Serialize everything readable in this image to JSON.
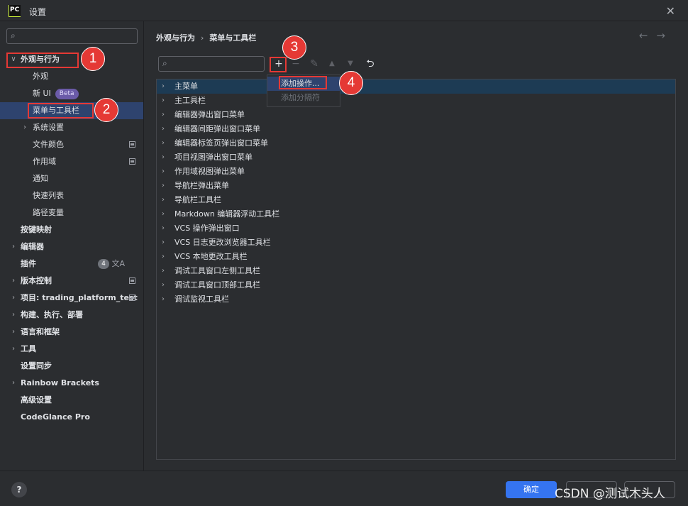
{
  "window": {
    "logo_text": "PC",
    "title": "设置",
    "close": "✕"
  },
  "sidebar": {
    "search_icon": "⌕",
    "items": [
      {
        "label": "外观与行为",
        "expanded": true,
        "bold": true
      },
      {
        "label": "外观"
      },
      {
        "label": "新 UI",
        "badge": "Beta"
      },
      {
        "label": "菜单与工具栏",
        "selected": true
      },
      {
        "label": "系统设置",
        "collapsed": true
      },
      {
        "label": "文件颜色"
      },
      {
        "label": "作用域"
      },
      {
        "label": "通知"
      },
      {
        "label": "快速列表"
      },
      {
        "label": "路径变量"
      },
      {
        "label": "按键映射",
        "bold": true
      },
      {
        "label": "编辑器",
        "bold": true
      },
      {
        "label": "插件",
        "bold": true,
        "count": "4",
        "translate_icon": "文A"
      },
      {
        "label": "版本控制",
        "bold": true
      },
      {
        "label": "项目: trading_platform_test",
        "bold": true
      },
      {
        "label": "构建、执行、部署",
        "bold": true
      },
      {
        "label": "语言和框架",
        "bold": true
      },
      {
        "label": "工具",
        "bold": true
      },
      {
        "label": "设置同步",
        "bold": true
      },
      {
        "label": "Rainbow Brackets",
        "bold": true
      },
      {
        "label": "高级设置",
        "bold": true
      },
      {
        "label": "CodeGlance Pro",
        "bold": true
      }
    ]
  },
  "main": {
    "breadcrumb": [
      "外观与行为",
      "菜单与工具栏"
    ],
    "breadcrumb_sep": "›",
    "nav_back": "←",
    "nav_forward": "→",
    "toolbar": {
      "add": "+",
      "remove": "−",
      "edit": "✎",
      "up": "▲",
      "down": "▼",
      "restore": "⮌"
    },
    "list": [
      "主菜单",
      "主工具栏",
      "编辑器弹出窗口菜单",
      "编辑器间距弹出窗口菜单",
      "编辑器标签页弹出窗口菜单",
      "项目视图弹出窗口菜单",
      "作用域视图弹出菜单",
      "导航栏弹出菜单",
      "导航栏工具栏",
      "Markdown 编辑器浮动工具栏",
      "VCS 操作弹出窗口",
      "VCS 日志更改浏览器工具栏",
      "VCS 本地更改工具栏",
      "调试工具窗口左侧工具栏",
      "调试工具窗口顶部工具栏",
      "调试监视工具栏"
    ],
    "dropdown": {
      "add_action": "添加操作...",
      "add_separator": "添加分隔符"
    }
  },
  "callouts": [
    "1",
    "2",
    "3",
    "4"
  ],
  "footer": {
    "help": "?",
    "ok": "确定",
    "watermark": "CSDN @测试木头人"
  },
  "colors": {
    "background": "#2b2d30",
    "selection": "#2e436e",
    "list_selection": "#1d3b54",
    "accent_button": "#3574f0",
    "callout_red": "#e53935",
    "beta_badge": "#6b5ba8"
  }
}
